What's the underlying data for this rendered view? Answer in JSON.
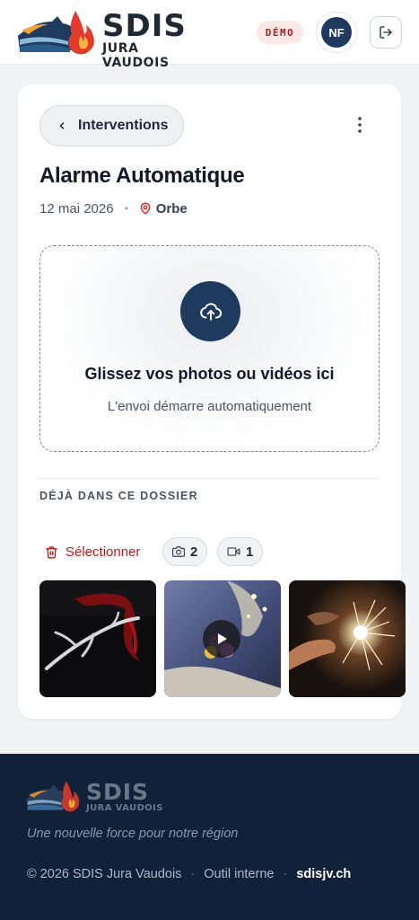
{
  "header": {
    "logo_main": "SDIS",
    "logo_sub": "JURA VAUDOIS",
    "demo_badge": "DÉMO",
    "avatar_initials": "NF",
    "logout_icon": "logout-icon"
  },
  "card": {
    "back_label": "Interventions",
    "back_icon": "chevron-left-icon",
    "more_icon": "more-vertical-icon",
    "title": "Alarme Automatique",
    "date": "12 mai 2026",
    "separator": "•",
    "location_icon": "map-pin-icon",
    "location": "Orbe",
    "dropzone": {
      "icon": "cloud-upload-icon",
      "title": "Glissez vos photos ou vidéos ici",
      "subtitle": "L'envoi démarre automatiquement"
    },
    "section_label": "DÉJÀ DANS CE DOSSIER",
    "select_label": "Sélectionner",
    "select_icon": "trash-icon",
    "photo_count": "2",
    "video_count": "1",
    "media": [
      {
        "kind": "photo",
        "subject": "white branch with red ribbon on dark background"
      },
      {
        "kind": "video",
        "subject": "flowers with lights"
      },
      {
        "kind": "photo",
        "subject": "sparkler in hand"
      }
    ]
  },
  "footer": {
    "logo_main": "SDIS",
    "logo_sub": "JURA VAUDOIS",
    "tagline": "Une nouvelle force pour notre région",
    "copyright": "© 2026 SDIS Jura Vaudois",
    "separator": "·",
    "internal": "Outil interne",
    "site": "sdisjv.ch"
  },
  "colors": {
    "primary": "#1f3a5f",
    "danger": "#b91c1c",
    "footer_bg": "#12213a"
  }
}
